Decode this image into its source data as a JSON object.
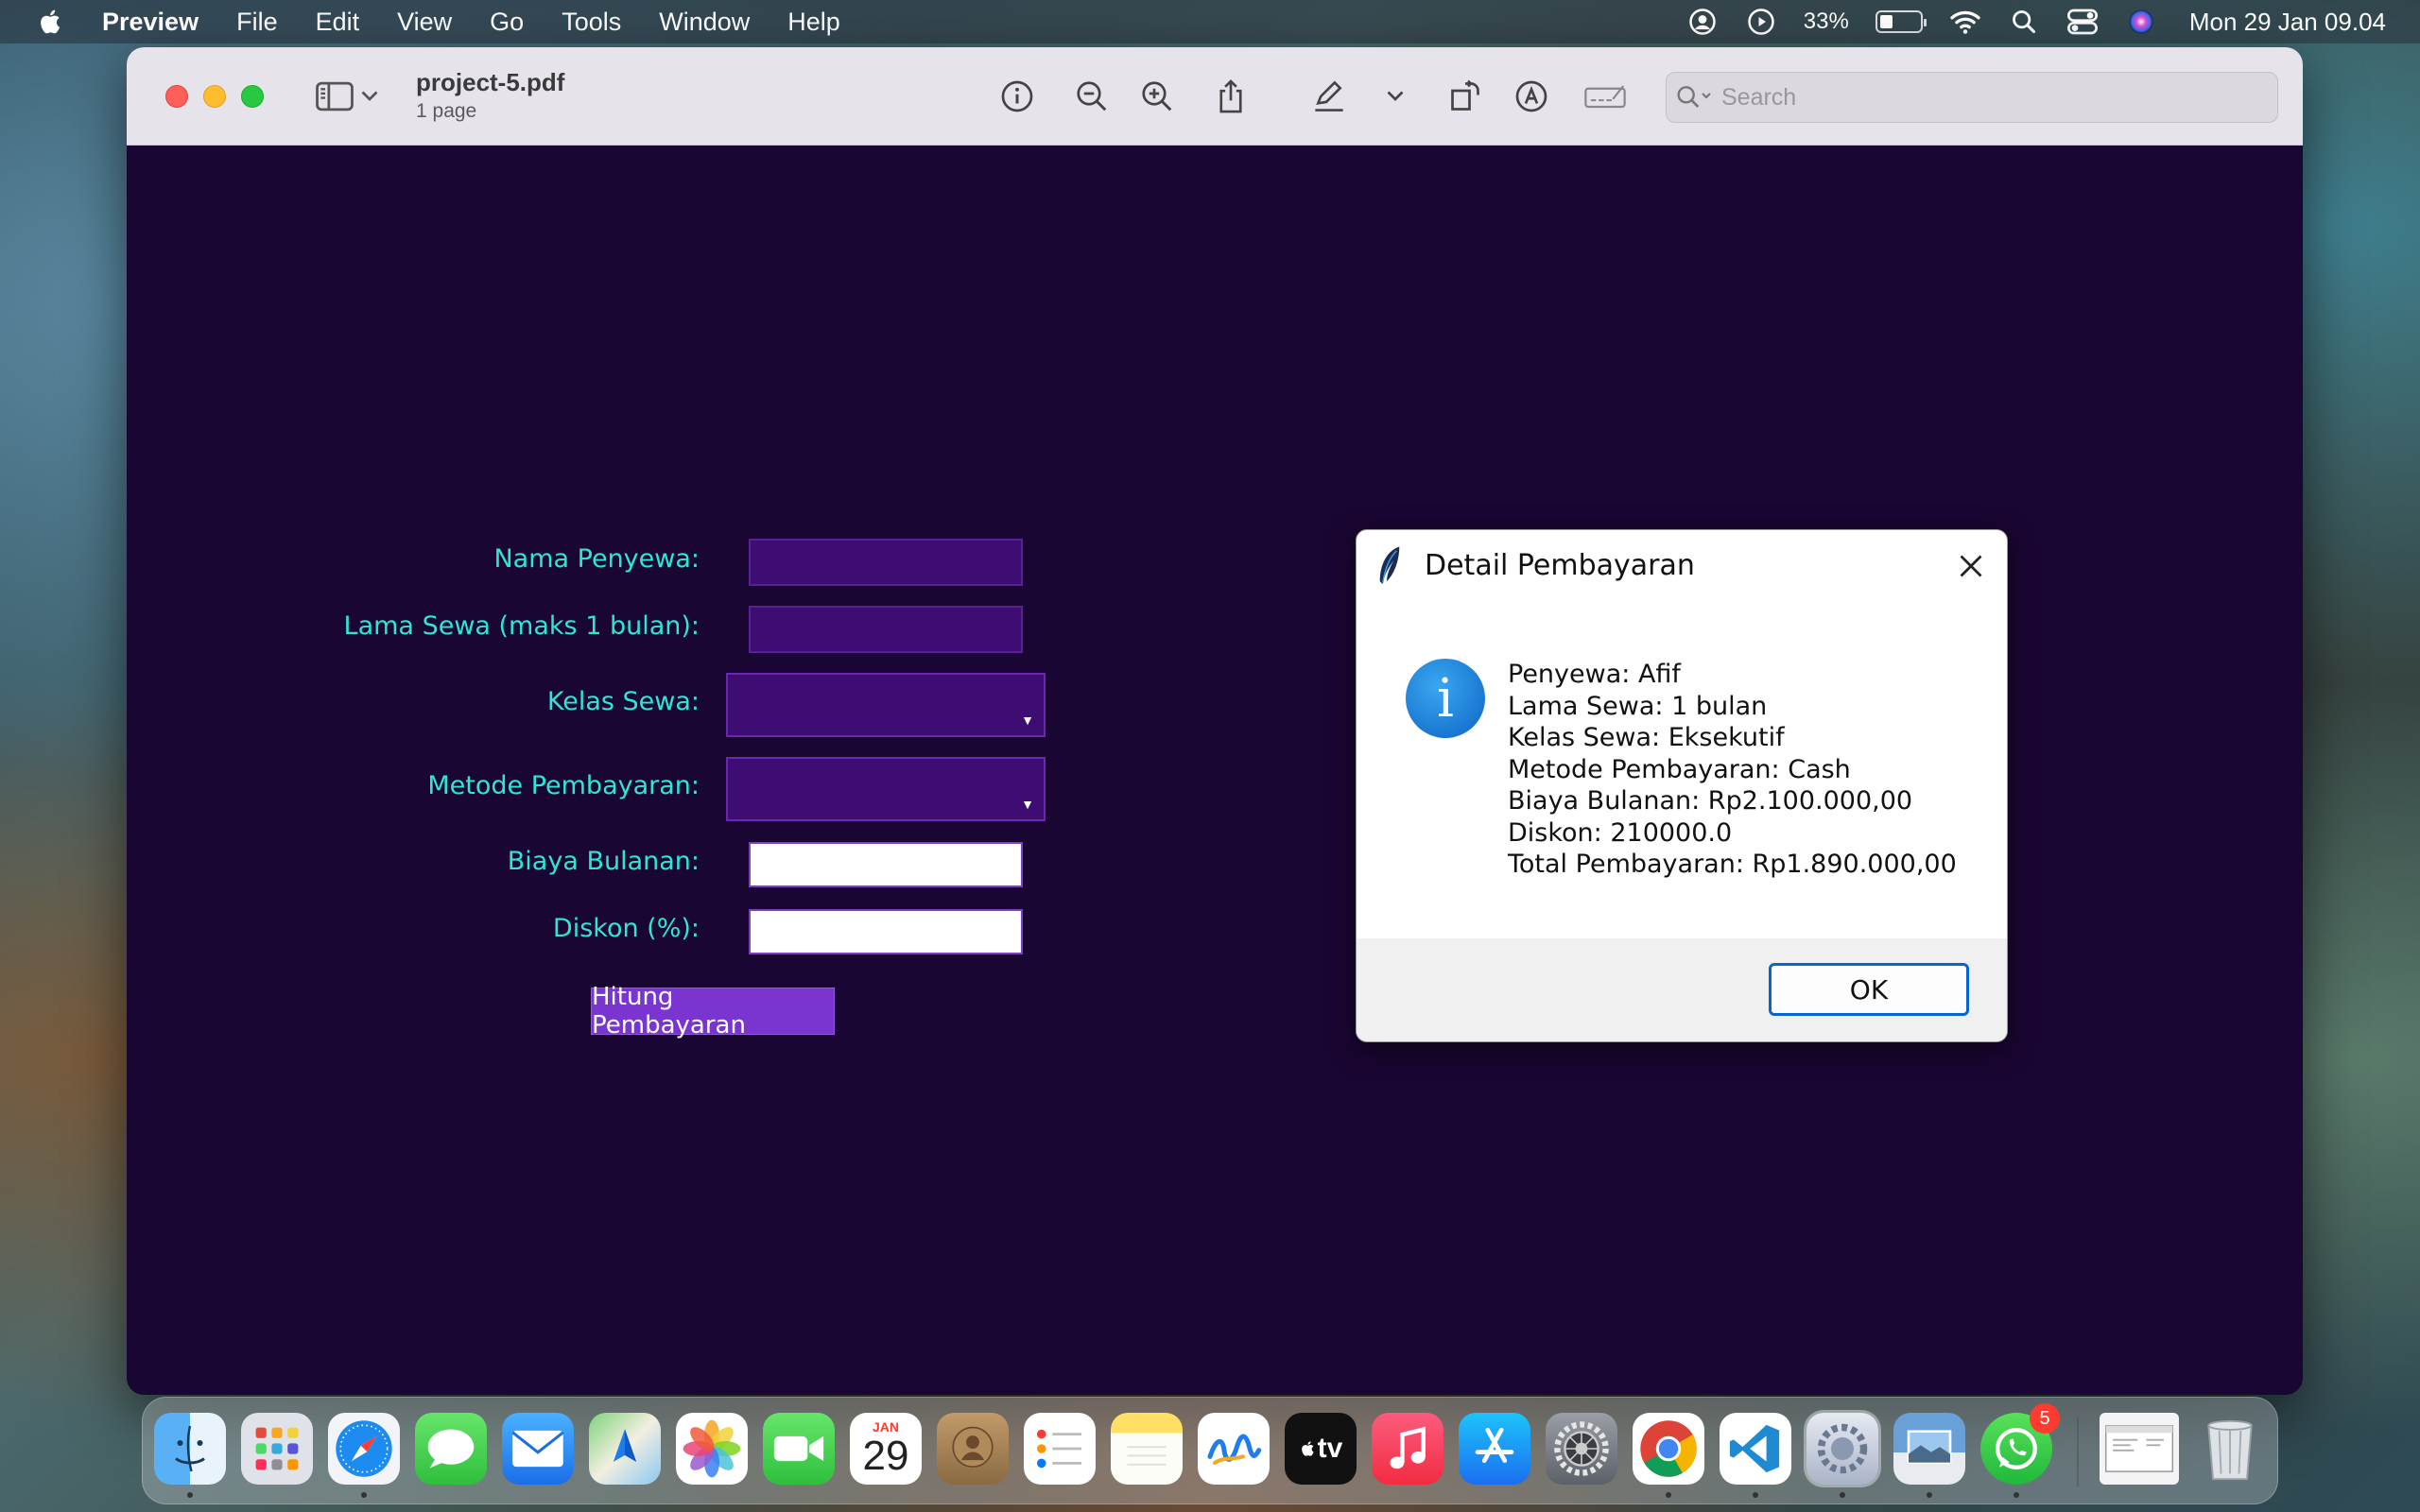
{
  "menubar": {
    "app_name": "Preview",
    "items": [
      "File",
      "Edit",
      "View",
      "Go",
      "Tools",
      "Window",
      "Help"
    ],
    "battery_percent": "33%",
    "battery_level": 0.33,
    "clock": "Mon 29 Jan  09.04"
  },
  "window": {
    "doc_title": "project-5.pdf",
    "doc_subtitle": "1 page",
    "search_placeholder": "Search"
  },
  "form": {
    "labels": {
      "nama": "Nama Penyewa:",
      "lama": "Lama Sewa (maks 1 bulan):",
      "kelas": "Kelas Sewa:",
      "metode": "Metode Pembayaran:",
      "biaya": "Biaya Bulanan:",
      "diskon": "Diskon (%):"
    },
    "values": {
      "nama": "",
      "lama": "",
      "kelas": "",
      "metode": "",
      "biaya": "",
      "diskon": ""
    },
    "button_label": "Hitung Pembayaran"
  },
  "dialog": {
    "title": "Detail Pembayaran",
    "info_glyph": "i",
    "lines": [
      "Penyewa: Afif",
      "Lama Sewa: 1 bulan",
      "Kelas Sewa: Eksekutif",
      "Metode Pembayaran: Cash",
      "Biaya Bulanan: Rp2.100.000,00",
      "Diskon: 210000.0",
      "Total Pembayaran: Rp1.890.000,00"
    ],
    "ok_label": "OK"
  },
  "dock": {
    "calendar_month": "JAN",
    "calendar_day": "29",
    "tv_label": "tv",
    "whatsapp_badge": "5"
  },
  "colors": {
    "app_bg": "#1a0632",
    "label_color": "#2ee6d6",
    "button_bg": "#7a35d0",
    "ok_border": "#0a64d0"
  }
}
